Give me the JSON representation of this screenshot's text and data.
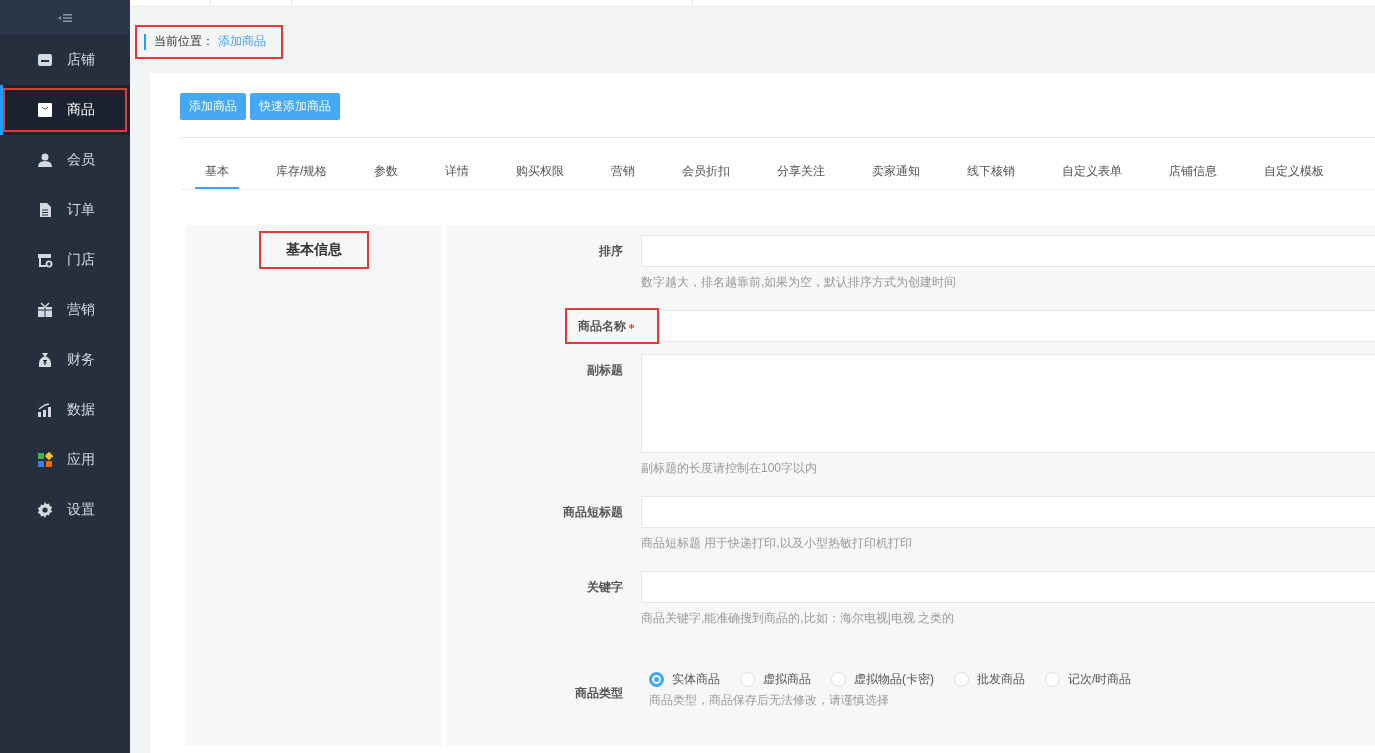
{
  "sidebar": {
    "items": [
      {
        "label": "店铺",
        "selected": false,
        "highlighted": false
      },
      {
        "label": "商品",
        "selected": true,
        "highlighted": true
      },
      {
        "label": "会员",
        "selected": false,
        "highlighted": false
      },
      {
        "label": "订单",
        "selected": false,
        "highlighted": false
      },
      {
        "label": "门店",
        "selected": false,
        "highlighted": false
      },
      {
        "label": "营销",
        "selected": false,
        "highlighted": false
      },
      {
        "label": "财务",
        "selected": false,
        "highlighted": false
      },
      {
        "label": "数据",
        "selected": false,
        "highlighted": false
      },
      {
        "label": "应用",
        "selected": false,
        "highlighted": false
      },
      {
        "label": "设置",
        "selected": false,
        "highlighted": false
      }
    ]
  },
  "breadcrumb": {
    "label": "当前位置：",
    "current": "添加商品",
    "highlighted": true
  },
  "buttons": [
    "添加商品",
    "快速添加商品"
  ],
  "tabs": [
    {
      "label": "基本",
      "selected": true
    },
    {
      "label": "库存/规格",
      "selected": false
    },
    {
      "label": "参数",
      "selected": false
    },
    {
      "label": "详情",
      "selected": false
    },
    {
      "label": "购买权限",
      "selected": false
    },
    {
      "label": "营销",
      "selected": false
    },
    {
      "label": "会员折扣",
      "selected": false
    },
    {
      "label": "分享关注",
      "selected": false
    },
    {
      "label": "卖家通知",
      "selected": false
    },
    {
      "label": "线下核销",
      "selected": false
    },
    {
      "label": "自定义表单",
      "selected": false
    },
    {
      "label": "店铺信息",
      "selected": false
    },
    {
      "label": "自定义模板",
      "selected": false
    }
  ],
  "section": {
    "title": "基本信息",
    "highlighted": true
  },
  "fields": [
    {
      "kind": "input",
      "label": "排序",
      "required": false,
      "highlighted": false,
      "hint": "数字越大，排名越靠前,如果为空，默认排序方式为创建时间"
    },
    {
      "kind": "input",
      "label": "商品名称",
      "required": true,
      "highlighted": true
    },
    {
      "kind": "textarea",
      "label": "副标题",
      "required": false,
      "highlighted": false,
      "hint": "副标题的长度请控制在100字以内"
    },
    {
      "kind": "input",
      "label": "商品短标题",
      "required": false,
      "highlighted": false,
      "hint": "商品短标题 用于快递打印,以及小型热敏打印机打印"
    },
    {
      "kind": "input",
      "label": "关键字",
      "required": false,
      "highlighted": false,
      "hint": "商品关键字,能准确搜到商品的,比如：海尔电视|电视 之类的"
    },
    {
      "kind": "radio",
      "label": "商品类型",
      "required": false,
      "highlighted": false,
      "options": [
        {
          "label": "实体商品",
          "selected": true
        },
        {
          "label": "虚拟商品",
          "selected": false
        },
        {
          "label": "虚拟物品(卡密)",
          "selected": false
        },
        {
          "label": "批发商品",
          "selected": false
        },
        {
          "label": "记次/时商品",
          "selected": false
        }
      ],
      "hint": "商品类型，商品保存后无法修改，请谨慎选择"
    }
  ]
}
